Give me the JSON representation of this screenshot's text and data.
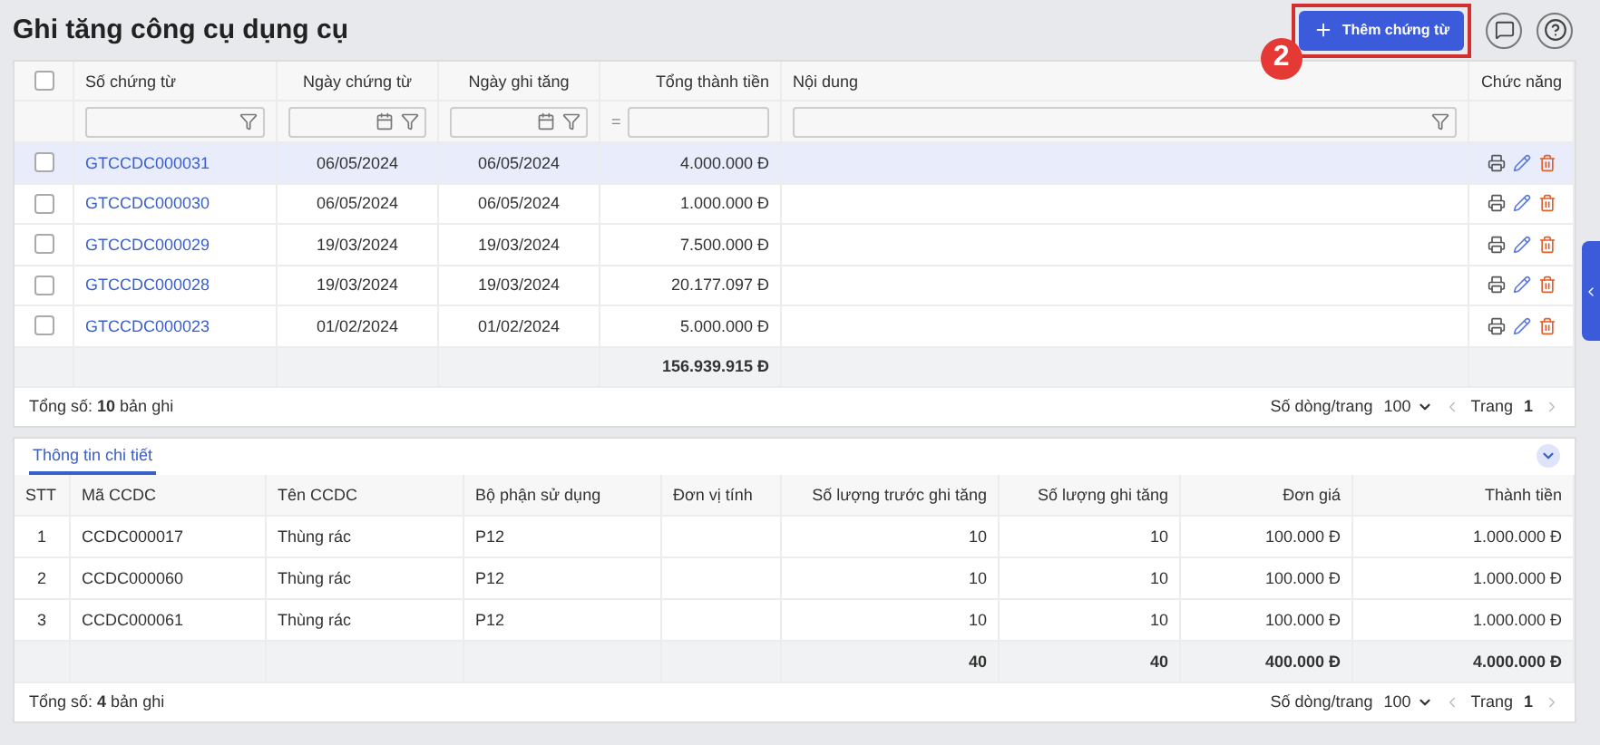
{
  "header": {
    "title": "Ghi tăng công cụ dụng cụ",
    "add_button": "Thêm chứng từ",
    "step_badge": "2"
  },
  "vouchers": {
    "columns": [
      "Số chứng từ",
      "Ngày chứng từ",
      "Ngày ghi tăng",
      "Tổng thành tiền",
      "Nội dung",
      "Chức năng"
    ],
    "amount_operator": "=",
    "select_all_checked": false,
    "rows": [
      {
        "number": "GTCCDC000031",
        "date": "06/05/2024",
        "posted": "06/05/2024",
        "total": "4.000.000 Đ",
        "selected": true,
        "checked": false
      },
      {
        "number": "GTCCDC000030",
        "date": "06/05/2024",
        "posted": "06/05/2024",
        "total": "1.000.000 Đ",
        "selected": false,
        "checked": false
      },
      {
        "number": "GTCCDC000029",
        "date": "19/03/2024",
        "posted": "19/03/2024",
        "total": "7.500.000 Đ",
        "selected": false,
        "checked": false
      },
      {
        "number": "GTCCDC000028",
        "date": "19/03/2024",
        "posted": "19/03/2024",
        "total": "20.177.097 Đ",
        "selected": false,
        "checked": false
      },
      {
        "number": "GTCCDC000023",
        "date": "01/02/2024",
        "posted": "01/02/2024",
        "total": "5.000.000 Đ",
        "selected": false,
        "checked": false
      }
    ],
    "sum_total": "156.939.915 Đ",
    "record_count": "Tổng số: **10** bản ghi",
    "pager": {
      "rows_label": "Số dòng/trang",
      "rows_per_page": "100",
      "page_label": "Trang",
      "page": "1"
    }
  },
  "details": {
    "tabs": [
      {
        "label": "Thông tin chi tiết",
        "selected": true
      }
    ],
    "columns": [
      "STT",
      "Mã CCDC",
      "Tên CCDC",
      "Bộ phận sử dụng",
      "Đơn vị tính",
      "Số lượng trước ghi tăng",
      "Số lượng ghi tăng",
      "Đơn giá",
      "Thành tiền"
    ],
    "rows": [
      {
        "stt": "1",
        "code": "CCDC000017",
        "name": "Thùng rác",
        "department": "P12",
        "qty_before": "10",
        "qty_added": "10",
        "unit_price": "100.000 Đ",
        "amount": "1.000.000 Đ"
      },
      {
        "stt": "2",
        "code": "CCDC000060",
        "name": "Thùng rác",
        "department": "P12",
        "qty_before": "10",
        "qty_added": "10",
        "unit_price": "100.000 Đ",
        "amount": "1.000.000 Đ"
      },
      {
        "stt": "3",
        "code": "CCDC000061",
        "name": "Thùng rác",
        "department": "P12",
        "qty_before": "10",
        "qty_added": "10",
        "unit_price": "100.000 Đ",
        "amount": "1.000.000 Đ"
      }
    ],
    "totals": {
      "qty_before": "40",
      "qty_added": "40",
      "unit_price": "400.000 Đ",
      "amount": "4.000.000 Đ"
    },
    "record_count": "Tổng số: **4** bản ghi",
    "pager": {
      "rows_label": "Số dòng/trang",
      "rows_per_page": "100",
      "page_label": "Trang",
      "page": "1"
    }
  }
}
